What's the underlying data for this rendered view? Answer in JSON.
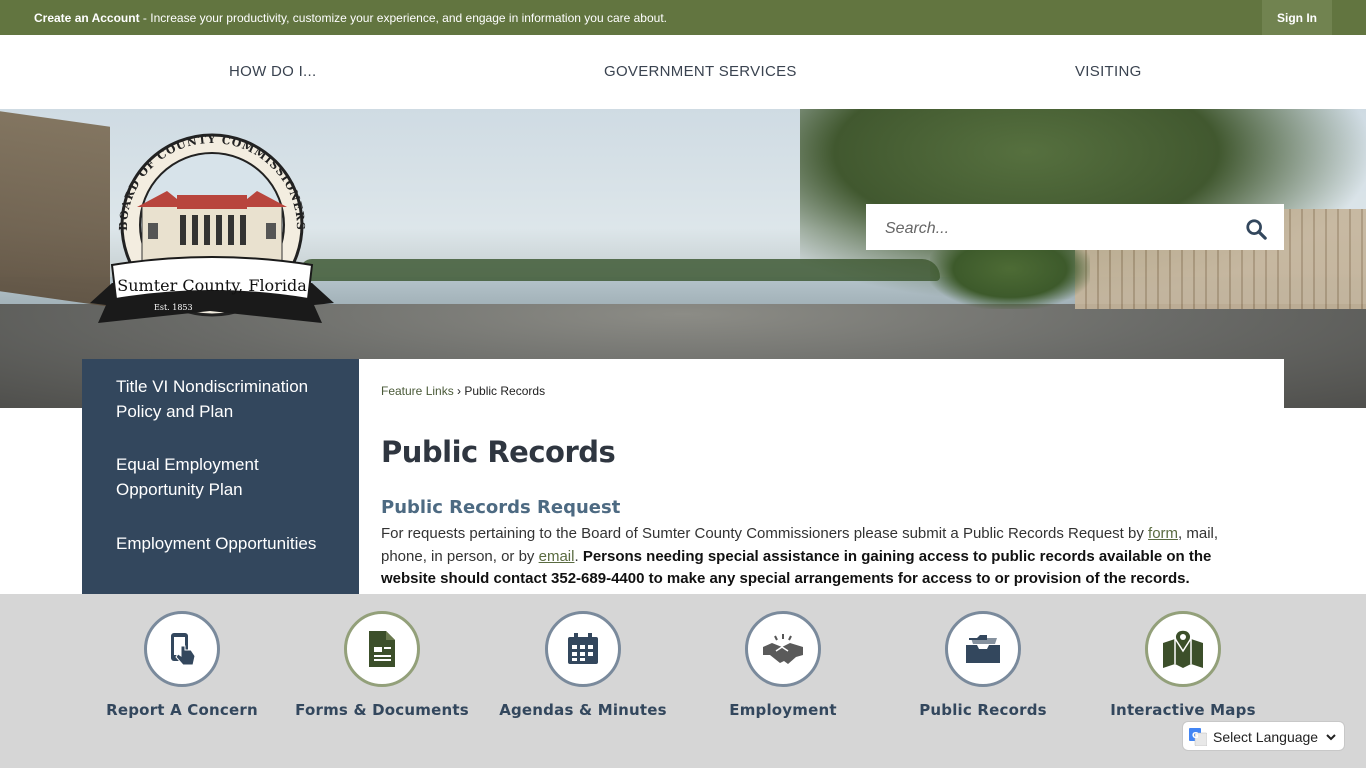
{
  "topbar": {
    "create_account": "Create an Account",
    "message": " - Increase your productivity, customize your experience, and engage in information you care about.",
    "sign_in": "Sign In",
    "color": "#627540"
  },
  "nav": {
    "items": [
      "HOW DO I...",
      "GOVERNMENT SERVICES",
      "VISITING"
    ]
  },
  "logo": {
    "top_text": "BOARD OF COUNTY COMMISSIONERS",
    "banner_text": "Sumter County, Florida",
    "est": "Est. 1853"
  },
  "search": {
    "placeholder": "Search...",
    "icon": "search-icon"
  },
  "sidebar": {
    "items": [
      "Title VI Nondiscrimination Policy and Plan",
      "Equal Employment Opportunity Plan",
      "Employment Opportunities"
    ],
    "color": "#33475d"
  },
  "breadcrumb": {
    "parent": "Feature Links",
    "separator": " › ",
    "current": "Public Records"
  },
  "content": {
    "title": "Public Records",
    "subhead": "Public Records Request",
    "para_1": "For requests pertaining to the Board of Sumter County Commissioners please submit a Public Records Request by ",
    "link_form": "form",
    "para_2": ", mail, phone, in person, or by ",
    "link_email": "email",
    "para_3": ". ",
    "bold_text": "Persons needing special assistance in gaining access to public records available on the website should contact 352-689-4400 to make any special arrangements for access to or provision of the records."
  },
  "features": [
    {
      "label": "Report A Concern",
      "icon": "phone-tap-icon"
    },
    {
      "label": "Forms & Documents",
      "icon": "document-icon"
    },
    {
      "label": "Agendas & Minutes",
      "icon": "calendar-icon"
    },
    {
      "label": "Employment",
      "icon": "handshake-icon"
    },
    {
      "label": "Public Records",
      "icon": "folder-tray-icon"
    },
    {
      "label": "Interactive Maps",
      "icon": "map-pin-icon"
    }
  ],
  "translate": {
    "label": "Select Language"
  }
}
